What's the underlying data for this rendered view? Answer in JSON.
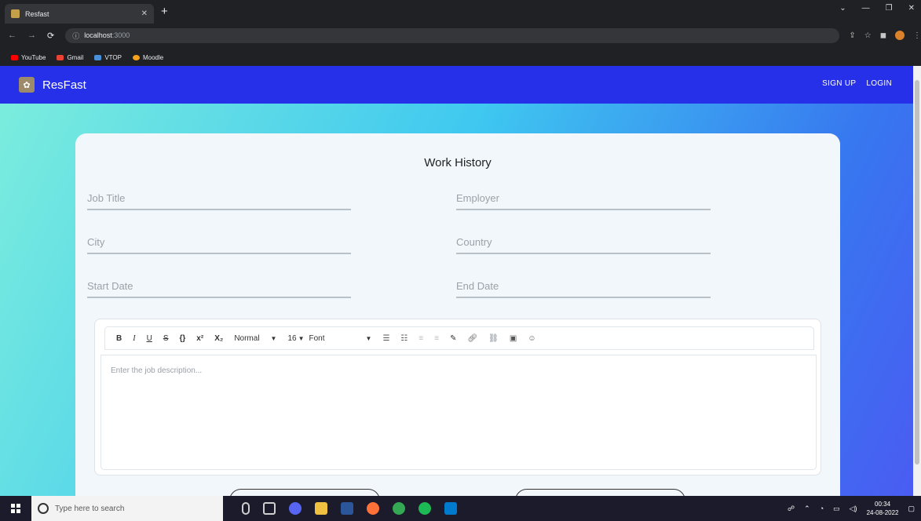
{
  "browser": {
    "tab_title": "Resfast",
    "tab_close": "✕",
    "new_tab": "+",
    "window_controls": [
      "⌄",
      "—",
      "❐",
      "✕"
    ],
    "address_host": "localhost",
    "address_port": ":3000",
    "extensions": [
      "⇪",
      "☆",
      "◼"
    ],
    "bookmarks": [
      {
        "label": "YouTube",
        "color": "#ff0000"
      },
      {
        "label": "Gmail",
        "color": "#ea4335"
      },
      {
        "label": "VTOP",
        "color": "#4a90d9"
      },
      {
        "label": "Moodle",
        "color": "#f7a21b"
      }
    ]
  },
  "navbar": {
    "brand": "ResFast",
    "links": [
      "SIGN UP",
      "LOGIN"
    ],
    "color": "#2530e8"
  },
  "form": {
    "heading": "Work History",
    "fields": {
      "job_title": "Job Title",
      "employer": "Employer",
      "city": "City",
      "country": "Country",
      "start_date": "Start Date",
      "end_date": "End Date"
    },
    "editor": {
      "bold": "B",
      "italic": "I",
      "underline": "U",
      "strike": "S",
      "code": "{}",
      "superscript": "x²",
      "subscript": "X₂",
      "heading_select": "Normal",
      "size_select": "16",
      "font_select": "Font",
      "dropdown_glyph": "▼",
      "placeholder": "Enter the job description..."
    }
  },
  "taskbar": {
    "search_placeholder": "Type here to search",
    "time": "00:34",
    "date": "24-08-2022",
    "apps": [
      {
        "name": "mic",
        "color": "#cfcfcf"
      },
      {
        "name": "task-view",
        "color": "#cfcfcf"
      },
      {
        "name": "discord",
        "color": "#5865f2"
      },
      {
        "name": "file-explorer",
        "color": "#f0c040"
      },
      {
        "name": "word",
        "color": "#2b579a"
      },
      {
        "name": "firefox",
        "color": "#ff7139"
      },
      {
        "name": "chrome",
        "color": "#34a853"
      },
      {
        "name": "spotify",
        "color": "#1db954"
      },
      {
        "name": "vscode",
        "color": "#007acc"
      }
    ]
  }
}
